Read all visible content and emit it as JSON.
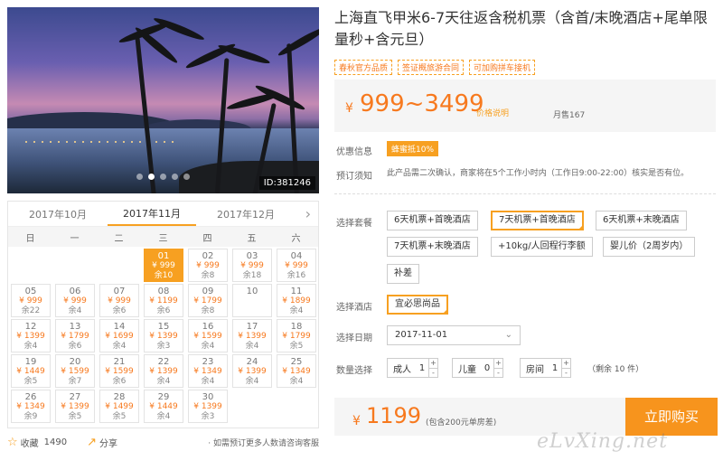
{
  "gallery": {
    "id_label": "ID:381246",
    "slide_count": 5,
    "active_slide": 1
  },
  "calendar": {
    "months": [
      "2017年10月",
      "2017年11月",
      "2017年12月"
    ],
    "active_month": 1,
    "weekdays": [
      "日",
      "一",
      "二",
      "三",
      "四",
      "五",
      "六"
    ],
    "days": [
      {
        "day": "01",
        "price": "¥ 999",
        "remain": "余10",
        "selected": true
      },
      {
        "day": "02",
        "price": "¥ 999",
        "remain": "余8"
      },
      {
        "day": "03",
        "price": "¥ 999",
        "remain": "余18"
      },
      {
        "day": "04",
        "price": "¥ 999",
        "remain": "余16"
      },
      {
        "day": "05",
        "price": "¥ 999",
        "remain": "余22"
      },
      {
        "day": "06",
        "price": "¥ 999",
        "remain": "余4"
      },
      {
        "day": "07",
        "price": "¥ 999",
        "remain": "余6"
      },
      {
        "day": "08",
        "price": "¥ 1199",
        "remain": "余6"
      },
      {
        "day": "09",
        "price": "¥ 1799",
        "remain": "余8"
      },
      {
        "day": "10",
        "price": "",
        "remain": ""
      },
      {
        "day": "11",
        "price": "¥ 1899",
        "remain": "余4"
      },
      {
        "day": "12",
        "price": "¥ 1399",
        "remain": "余4"
      },
      {
        "day": "13",
        "price": "¥ 1799",
        "remain": "余6"
      },
      {
        "day": "14",
        "price": "¥ 1699",
        "remain": "余4"
      },
      {
        "day": "15",
        "price": "¥ 1399",
        "remain": "余3"
      },
      {
        "day": "16",
        "price": "¥ 1599",
        "remain": "余4"
      },
      {
        "day": "17",
        "price": "¥ 1399",
        "remain": "余4"
      },
      {
        "day": "18",
        "price": "¥ 1799",
        "remain": "余5"
      },
      {
        "day": "19",
        "price": "¥ 1449",
        "remain": "余5"
      },
      {
        "day": "20",
        "price": "¥ 1599",
        "remain": "余7"
      },
      {
        "day": "21",
        "price": "¥ 1599",
        "remain": "余6"
      },
      {
        "day": "22",
        "price": "¥ 1399",
        "remain": "余4"
      },
      {
        "day": "23",
        "price": "¥ 1349",
        "remain": "余4"
      },
      {
        "day": "24",
        "price": "¥ 1399",
        "remain": "余4"
      },
      {
        "day": "25",
        "price": "¥ 1349",
        "remain": "余4"
      },
      {
        "day": "26",
        "price": "¥ 1349",
        "remain": "余9"
      },
      {
        "day": "27",
        "price": "¥ 1399",
        "remain": "余5"
      },
      {
        "day": "28",
        "price": "¥ 1499",
        "remain": "余5"
      },
      {
        "day": "29",
        "price": "¥ 1449",
        "remain": "余4"
      },
      {
        "day": "30",
        "price": "¥ 1399",
        "remain": "余3"
      }
    ],
    "first_weekday": 3
  },
  "footer": {
    "favorite_label": "收藏",
    "favorite_count": "1490",
    "share_label": "分享",
    "consult_text": "· 如需预订更多人数请咨询客服"
  },
  "product": {
    "title": "上海直飞甲米6-7天往返含税机票（含首/末晚酒店+尾单限量秒+含元旦）",
    "tags": [
      "春秋官方品质",
      "签证概旅游合同",
      "可加购拼车接机"
    ],
    "price_currency": "¥",
    "price_range": "999~3499",
    "price_explain": "价格说明",
    "monthly_sales": "月售167"
  },
  "promo": {
    "label": "优惠信息",
    "badge": "蜂蜜抵10%"
  },
  "notice": {
    "label": "预订须知",
    "text": "此产品需二次确认，商家将在5个工作小时内（工作日9:00-22:00）核实是否有位。"
  },
  "packages": {
    "label": "选择套餐",
    "options": [
      {
        "label": "6天机票+首晚酒店",
        "selected": false
      },
      {
        "label": "7天机票+首晚酒店",
        "selected": true
      },
      {
        "label": "6天机票+末晚酒店",
        "selected": false
      },
      {
        "label": "7天机票+末晚酒店",
        "selected": false
      },
      {
        "label": "+10kg/人回程行李额",
        "selected": false
      },
      {
        "label": "婴儿价（2周岁内）",
        "selected": false
      },
      {
        "label": "补差",
        "selected": false
      }
    ]
  },
  "hotel": {
    "label": "选择酒店",
    "options": [
      {
        "label": "宜必思尚品",
        "selected": true
      }
    ]
  },
  "date": {
    "label": "选择日期",
    "value": "2017-11-01"
  },
  "quantity": {
    "label": "数量选择",
    "adult_label": "成人",
    "adult_value": "1",
    "child_label": "儿童",
    "child_value": "0",
    "room_label": "房间",
    "room_value": "1",
    "remaining": "（剩余 10 件）"
  },
  "total": {
    "currency": "¥",
    "amount": "1199",
    "note": "(包含200元单房差)"
  },
  "buy_button": "立即购买",
  "watermark": "eLvXing.net",
  "colors": {
    "accent": "#f7a021",
    "price": "#f7791e",
    "buy_button": "#f7941d"
  }
}
